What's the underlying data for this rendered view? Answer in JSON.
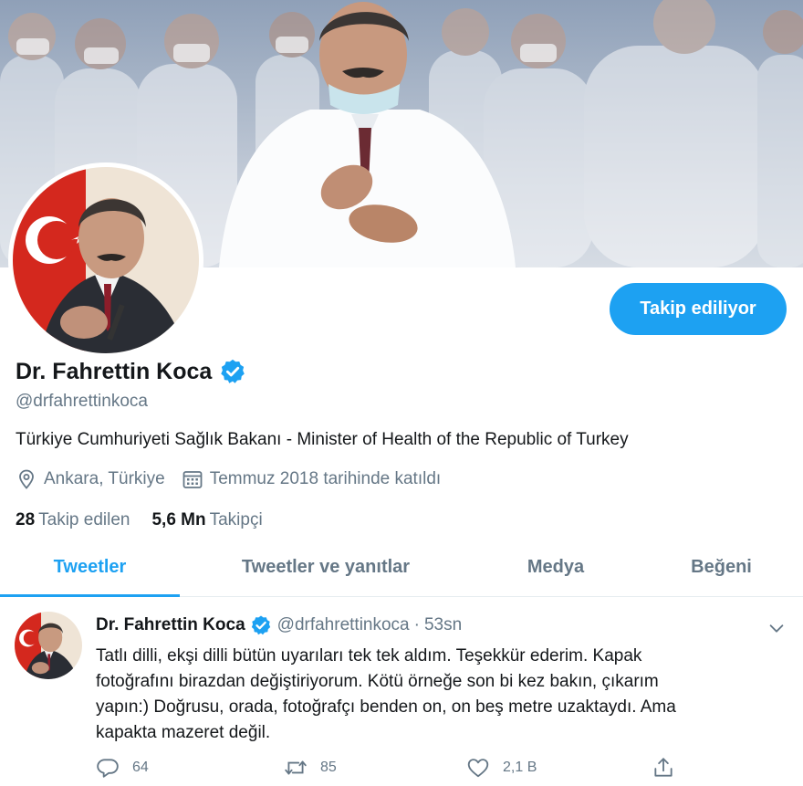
{
  "profile": {
    "display_name": "Dr. Fahrettin Koca",
    "handle": "@drfahrettinkoca",
    "bio": "Türkiye Cumhuriyeti Sağlık Bakanı - Minister of Health of the Republic of Turkey",
    "location": "Ankara, Türkiye",
    "joined": "Temmuz 2018 tarihinde katıldı",
    "verified": true
  },
  "follow_button": {
    "label": "Takip ediliyor"
  },
  "stats": {
    "following_count": "28",
    "following_label": "Takip edilen",
    "followers_count": "5,6 Mn",
    "followers_label": "Takipçi"
  },
  "tabs": [
    {
      "label": "Tweetler",
      "active": true
    },
    {
      "label": "Tweetler ve yanıtlar",
      "active": false
    },
    {
      "label": "Medya",
      "active": false
    },
    {
      "label": "Beğeni",
      "active": false
    }
  ],
  "tweet": {
    "name": "Dr. Fahrettin Koca",
    "handle": "@drfahrettinkoca",
    "separator": "·",
    "time": "53sn",
    "text": "Tatlı dilli, ekşi dilli bütün uyarıları tek tek aldım. Teşekkür ederim. Kapak\nfotoğrafını birazdan değiştiriyorum. Kötü örneğe son bi kez bakın, çıkarım\nyapın:) Doğrusu, orada, fotoğrafçı benden on, on beş metre uzaktaydı. Ama\nkapakta mazeret değil.",
    "replies": "64",
    "retweets": "85",
    "likes": "2,1 B"
  },
  "icons": {
    "verified": "verified-badge-icon",
    "location": "location-pin-icon",
    "calendar": "calendar-icon",
    "reply": "reply-icon",
    "retweet": "retweet-icon",
    "like": "heart-icon",
    "share": "share-icon",
    "more": "chevron-down-icon"
  },
  "colors": {
    "accent": "#1da1f2",
    "text_primary": "#14171a",
    "text_secondary": "#657786",
    "divider": "#e6ecf0"
  }
}
